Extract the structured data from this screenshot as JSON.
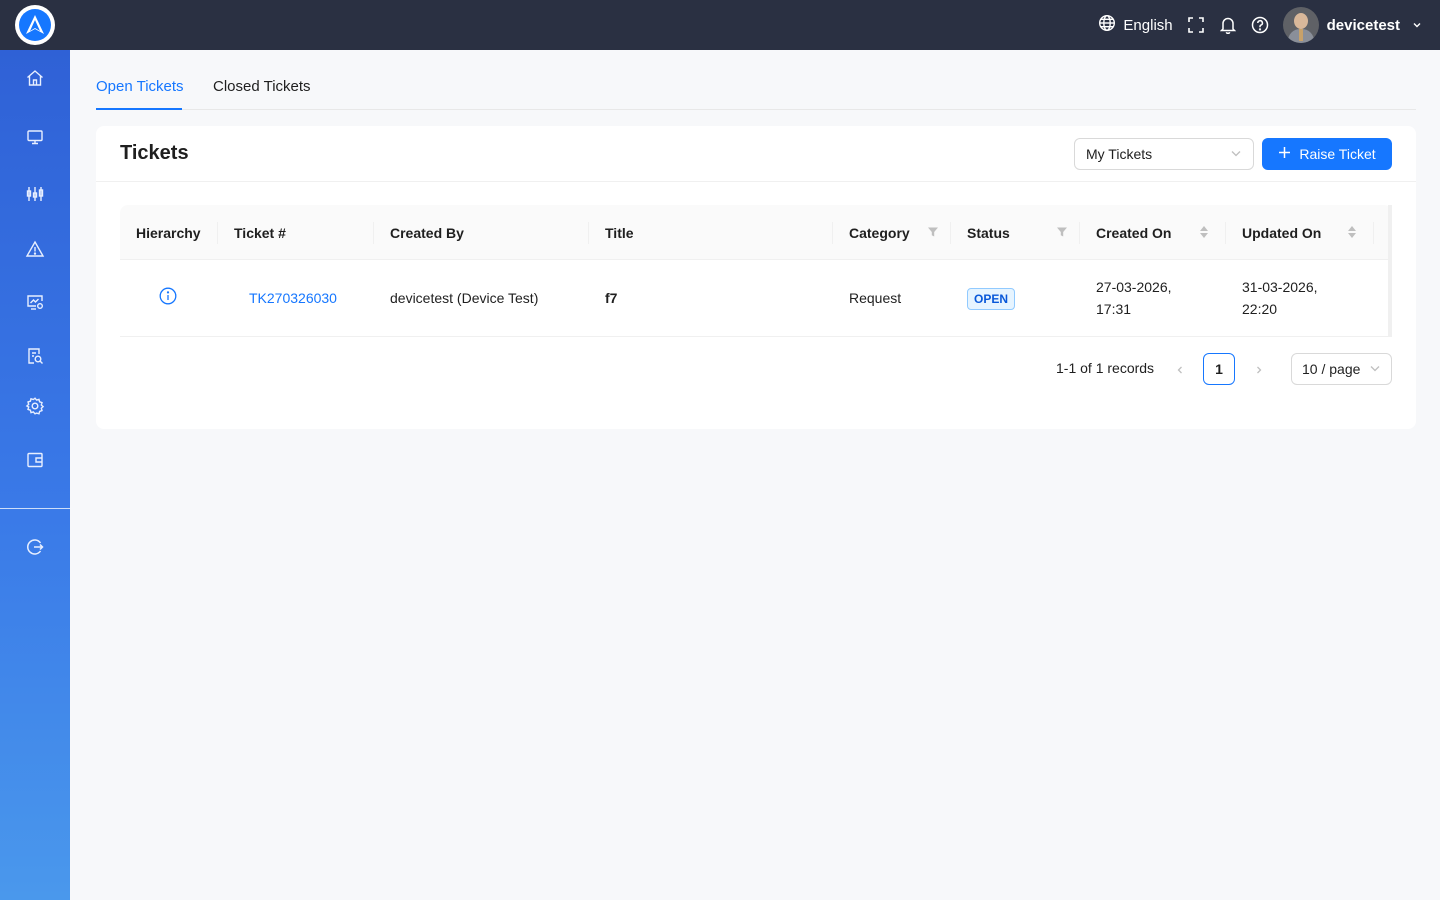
{
  "header": {
    "language": "English",
    "username": "devicetest",
    "icons": [
      "globe-icon",
      "fullscreen-icon",
      "bell-icon",
      "help-icon",
      "chevron-down-icon"
    ]
  },
  "sidebar": {
    "items": [
      {
        "name": "home",
        "icon": "home-icon"
      },
      {
        "name": "devices",
        "icon": "monitor-icon"
      },
      {
        "name": "analytics",
        "icon": "sliders-icon"
      },
      {
        "name": "alerts",
        "icon": "warning-icon"
      },
      {
        "name": "device-settings",
        "icon": "monitor-gear-icon"
      },
      {
        "name": "reports",
        "icon": "report-search-icon"
      },
      {
        "name": "settings",
        "icon": "gear-icon"
      },
      {
        "name": "wallet",
        "icon": "wallet-icon"
      },
      {
        "name": "logout",
        "icon": "logout-icon"
      }
    ]
  },
  "tabs": [
    {
      "label": "Open Tickets",
      "active": true
    },
    {
      "label": "Closed Tickets",
      "active": false
    }
  ],
  "card": {
    "title": "Tickets",
    "filter_select": "My Tickets",
    "raise_button": "Raise Ticket"
  },
  "table": {
    "columns": [
      "Hierarchy",
      "Ticket #",
      "Created By",
      "Title",
      "Category",
      "Status",
      "Created On",
      "Updated On"
    ],
    "rows": [
      {
        "ticket": "TK270326030",
        "created_by": "devicetest (Device Test)",
        "title": "f7",
        "category": "Request",
        "status": "OPEN",
        "created_on_date": "27-03-2026,",
        "created_on_time": "17:31",
        "updated_on_date": "31-03-2026,",
        "updated_on_time": "22:20"
      }
    ]
  },
  "pagination": {
    "records": "1-1 of 1 records",
    "current_page": "1",
    "page_size": "10 / page"
  },
  "colors": {
    "primary": "#1677ff",
    "topbar": "#2a3042",
    "sidebar_top": "#2f61d6",
    "sidebar_bottom": "#4a98ec"
  }
}
